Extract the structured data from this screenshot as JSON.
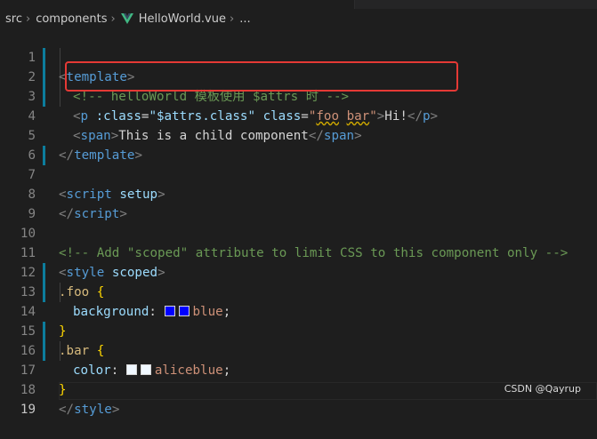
{
  "breadcrumb": {
    "src": "src",
    "components": "components",
    "file": "HelloWorld.vue",
    "more": "..."
  },
  "gutter": [
    "1",
    "2",
    "3",
    "4",
    "5",
    "6",
    "7",
    "8",
    "9",
    "10",
    "11",
    "12",
    "13",
    "14",
    "15",
    "16",
    "17",
    "18",
    "19"
  ],
  "code": {
    "l1": {
      "open": "<",
      "tag": "template",
      "close": ">"
    },
    "l2": {
      "comment": "<!-- helloWorld 模板使用 $attrs 时 -->"
    },
    "l3": {
      "lt": "<",
      "tag": "p",
      "attr1": ":class",
      "eq1": "=",
      "val1": "\"$attrs.class\"",
      "attr2": "class",
      "eq2": "=",
      "q1": "\"",
      "foo": "foo",
      "bar": "bar",
      "q2": "\"",
      "gt": ">",
      "text": "Hi!",
      "endtag": "</",
      "tag2": "p",
      "gt2": ">"
    },
    "l4": {
      "lt": "<",
      "tag": "span",
      "gt": ">",
      "text": "This is a child component",
      "lt2": "</",
      "tag2": "span",
      "gt2": ">"
    },
    "l5": {
      "lt": "</",
      "tag": "template",
      "gt": ">"
    },
    "l7": {
      "lt": "<",
      "tag": "script",
      "attr": "setup",
      "gt": ">"
    },
    "l8": {
      "lt": "</",
      "tag": "script",
      "gt": ">"
    },
    "l10": {
      "comment": "<!-- Add \"scoped\" attribute to limit CSS to this component only -->"
    },
    "l11": {
      "lt": "<",
      "tag": "style",
      "attr": "scoped",
      "gt": ">"
    },
    "l12": {
      "selector": ".foo",
      "brace": " {"
    },
    "l13": {
      "prop": "background",
      "colon": ": ",
      "value": "blue",
      "semi": ";"
    },
    "l14": {
      "brace": "}"
    },
    "l15": {
      "selector": ".bar",
      "brace": " {"
    },
    "l16": {
      "prop": "color",
      "colon": ": ",
      "value": "aliceblue",
      "semi": ";"
    },
    "l17": {
      "brace": "}"
    },
    "l18": {
      "lt": "</",
      "tag": "style",
      "gt": ">"
    }
  },
  "colors": {
    "blue": "#0000ff",
    "aliceblue": "#f0f8ff",
    "highlight": "#e53935"
  },
  "watermark": "CSDN @Qayrup"
}
